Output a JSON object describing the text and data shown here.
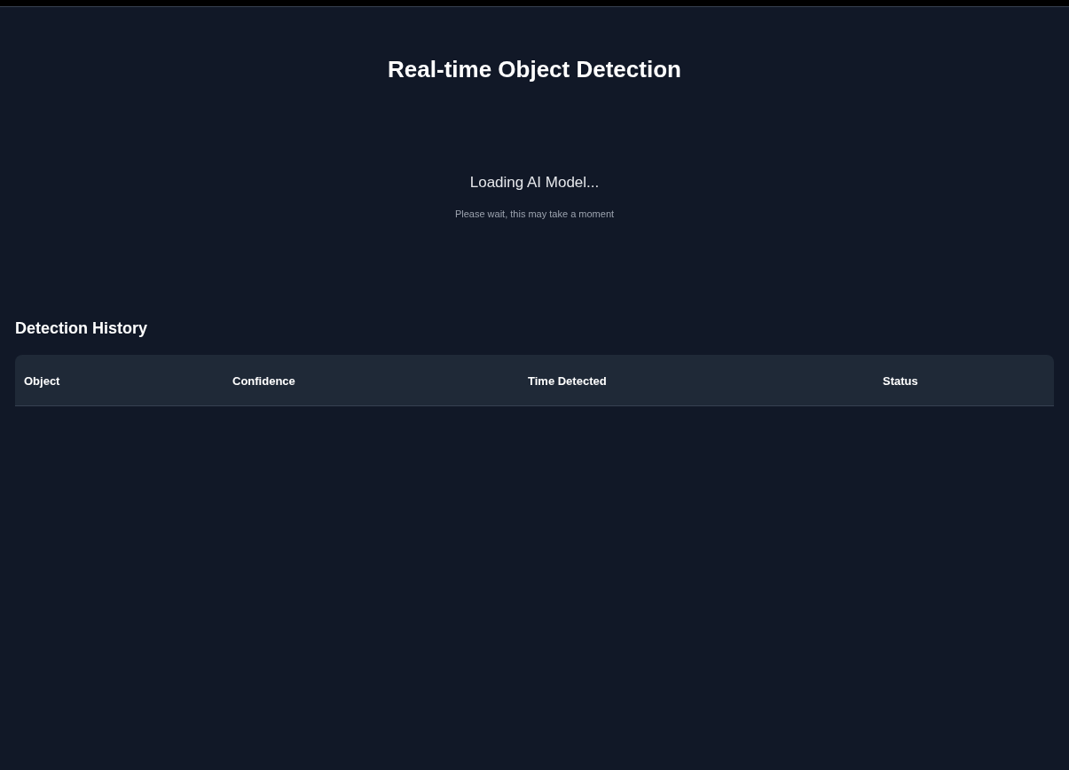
{
  "title": "Real-time Object Detection",
  "loading": {
    "heading": "Loading AI Model...",
    "message": "Please wait, this may take a moment"
  },
  "history": {
    "title": "Detection History",
    "columns": [
      "Object",
      "Confidence",
      "Time Detected",
      "Status"
    ]
  }
}
